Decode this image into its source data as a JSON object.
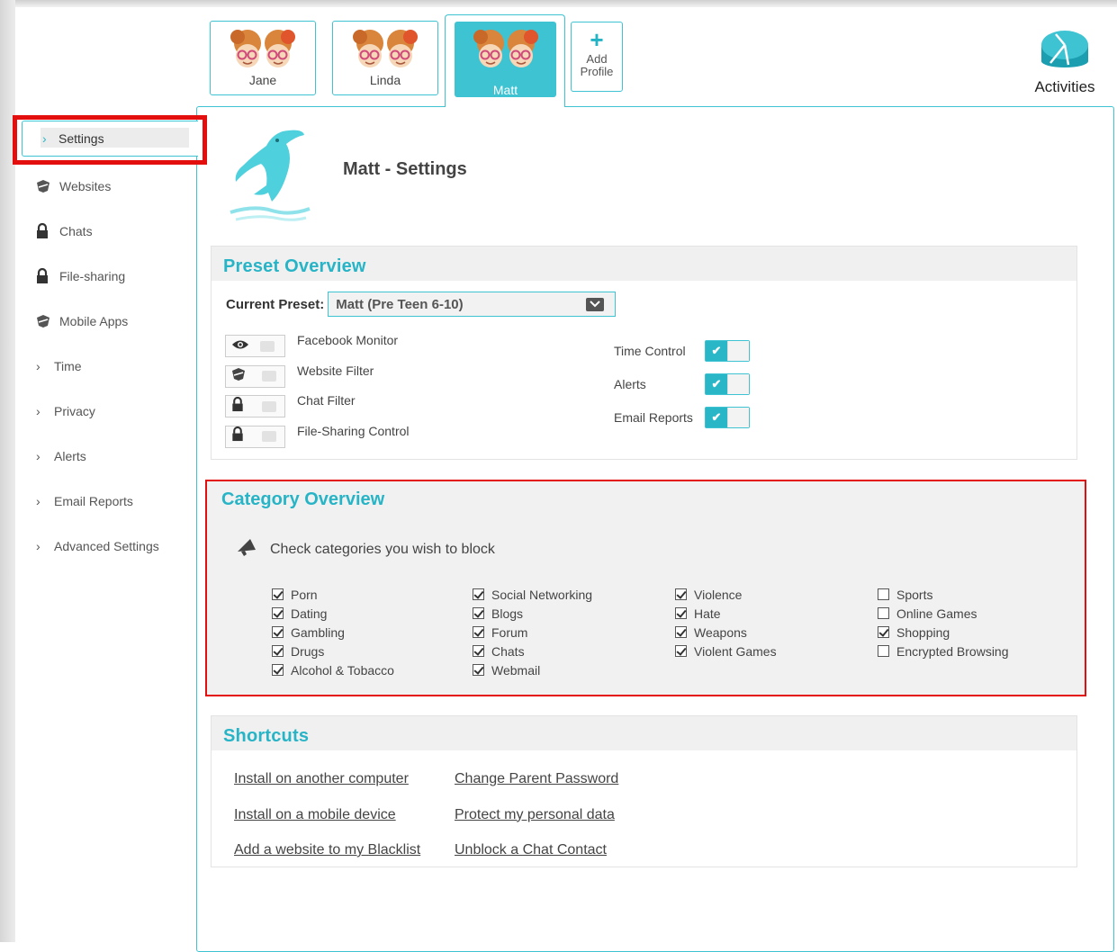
{
  "profiles": [
    {
      "name": "Jane"
    },
    {
      "name": "Linda"
    },
    {
      "name": "Matt",
      "active": true
    }
  ],
  "add_profile": {
    "line1": "Add",
    "line2": "Profile"
  },
  "activities": {
    "label": "Activities"
  },
  "sidebar": {
    "items": [
      {
        "label": "Settings",
        "icon": "chevron-right-icon",
        "active": true
      },
      {
        "label": "Websites",
        "icon": "shield-icon"
      },
      {
        "label": "Chats",
        "icon": "lock-icon"
      },
      {
        "label": "File-sharing",
        "icon": "lock-icon"
      },
      {
        "label": "Mobile Apps",
        "icon": "shield-icon"
      },
      {
        "label": "Time",
        "icon": "chevron-right-icon"
      },
      {
        "label": "Privacy",
        "icon": "chevron-right-icon"
      },
      {
        "label": "Alerts",
        "icon": "chevron-right-icon"
      },
      {
        "label": "Email Reports",
        "icon": "chevron-right-icon"
      },
      {
        "label": "Advanced Settings",
        "icon": "chevron-right-icon"
      }
    ]
  },
  "header": {
    "title": "Matt - Settings"
  },
  "preset": {
    "title": "Preset Overview",
    "current_label": "Current Preset:",
    "current_value": "Matt (Pre Teen 6-10)",
    "features": [
      {
        "name": "Facebook Monitor",
        "icon": "eye-icon"
      },
      {
        "name": "Website Filter",
        "icon": "shield-icon"
      },
      {
        "name": "Chat Filter",
        "icon": "lock-icon"
      },
      {
        "name": "File-Sharing Control",
        "icon": "lock-icon"
      }
    ],
    "toggles": [
      {
        "label": "Time Control",
        "on": true
      },
      {
        "label": "Alerts",
        "on": true
      },
      {
        "label": "Email Reports",
        "on": true
      }
    ]
  },
  "category": {
    "title": "Category Overview",
    "hint": "Check categories you wish to block",
    "columns": [
      [
        {
          "label": "Porn",
          "checked": true
        },
        {
          "label": "Dating",
          "checked": true
        },
        {
          "label": "Gambling",
          "checked": true
        },
        {
          "label": "Drugs",
          "checked": true
        },
        {
          "label": "Alcohol & Tobacco",
          "checked": true
        }
      ],
      [
        {
          "label": "Social Networking",
          "checked": true
        },
        {
          "label": "Blogs",
          "checked": true
        },
        {
          "label": "Forum",
          "checked": true
        },
        {
          "label": "Chats",
          "checked": true
        },
        {
          "label": "Webmail",
          "checked": true
        }
      ],
      [
        {
          "label": "Violence",
          "checked": true
        },
        {
          "label": "Hate",
          "checked": true
        },
        {
          "label": "Weapons",
          "checked": true
        },
        {
          "label": "Violent Games",
          "checked": true
        }
      ],
      [
        {
          "label": "Sports",
          "checked": false
        },
        {
          "label": "Online Games",
          "checked": false
        },
        {
          "label": "Shopping",
          "checked": true
        },
        {
          "label": "Encrypted Browsing",
          "checked": false
        }
      ]
    ]
  },
  "shortcuts": {
    "title": "Shortcuts",
    "left": [
      "Install on another computer",
      "Install on a mobile device",
      "Add a website to my Blacklist"
    ],
    "right": [
      "Change Parent Password",
      "Protect my personal data",
      "Unblock a Chat Contact"
    ]
  },
  "colors": {
    "accent": "#3ec3d3",
    "title": "#27b4c6",
    "highlight": "#e30f0f"
  }
}
